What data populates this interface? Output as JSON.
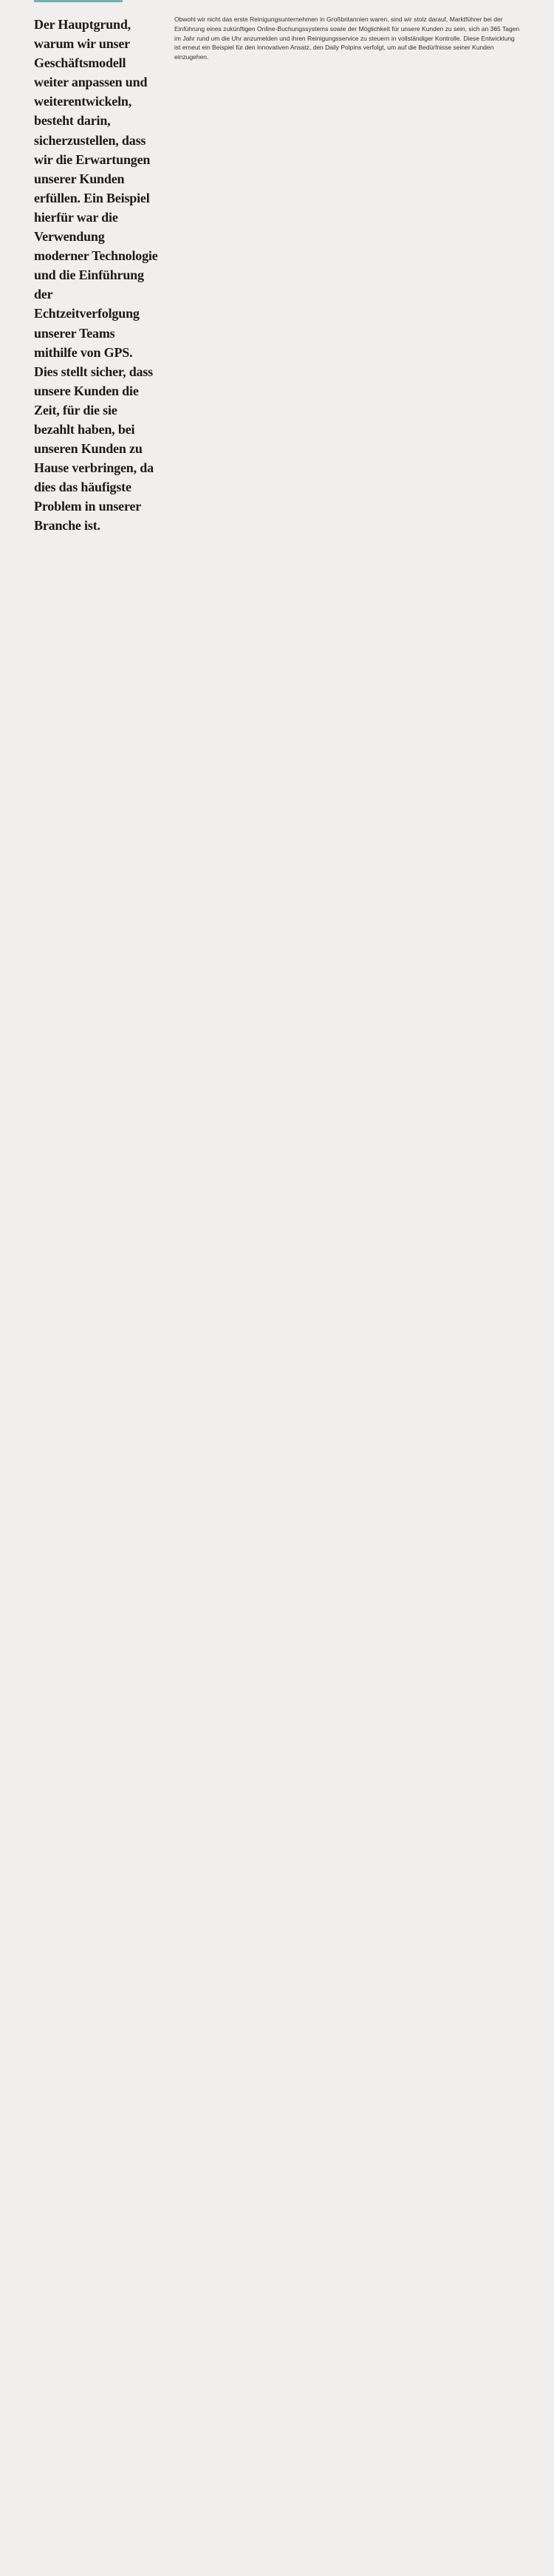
{
  "page": {
    "background_color": "#f0efed",
    "accent_color": "#6ab4b4"
  },
  "main_text": "Der Hauptgrund, warum wir unser Geschäftsmodell weiter anpassen und weiterentwickeln, besteht darin, sicherzustellen, dass wir die Erwartungen unserer Kunden erfüllen. Ein Beispiel hierfür war die Verwendung moderner Technologie und die Einführung der Echtzeitverfolgung unserer Teams mithilfe von GPS. Dies stellt sicher, dass unsere Kunden die Zeit, für die sie bezahlt haben, bei unseren Kunden zu Hause verbringen, da dies das häufigste Problem in unserer Branche ist.",
  "side_text": "Obwohl wir nicht das erste Reinigungsunternehmen in Großbritannien waren, sind wir stolz darauf, Marktführer bei der Einführung eines zukünftigen Online-Buchungssystems sowie der Möglichkeit für unsere Kunden zu sein, sich an 365 Tagen im Jahr rund um die Uhr anzumelden und ihren Reinigungsservice zu steuern in vollständiger Kontrolle. Diese Entwicklung ist erneut ein Beispiel für den innovativen Ansatz, den Daily Polpins verfolgt, um auf die Bedürfnisse seiner Kunden einzugehen."
}
